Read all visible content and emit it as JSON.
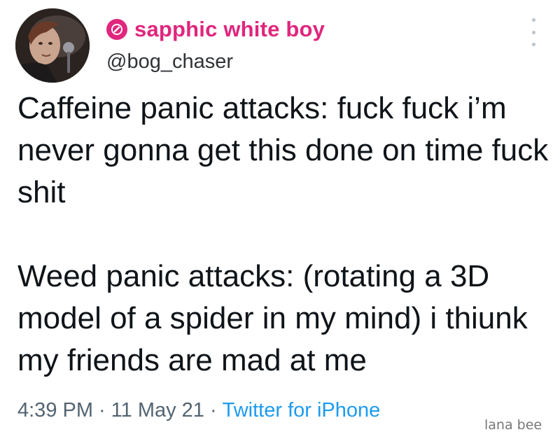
{
  "author": {
    "display_name": "sapphic white boy",
    "handle": "@bog_chaser"
  },
  "icons": {
    "badge": "pink-circle-badge-icon",
    "more": "more-vertical-icon",
    "avatar": "profile-photo"
  },
  "colors": {
    "display_name": "#e0267d",
    "meta": "#536471",
    "source_link": "#1d9bf0"
  },
  "tweet": {
    "paragraph1": "Caffeine panic attacks: fuck fuck i’m never gonna get this done on time fuck shit",
    "paragraph2": "Weed panic attacks: (rotating a 3D model of a spider in my mind) i thiunk my friends are mad at me"
  },
  "meta": {
    "time": "4:39 PM",
    "separator": "·",
    "date": "11 May 21",
    "source": "Twitter for iPhone"
  },
  "watermark": "lana bee"
}
